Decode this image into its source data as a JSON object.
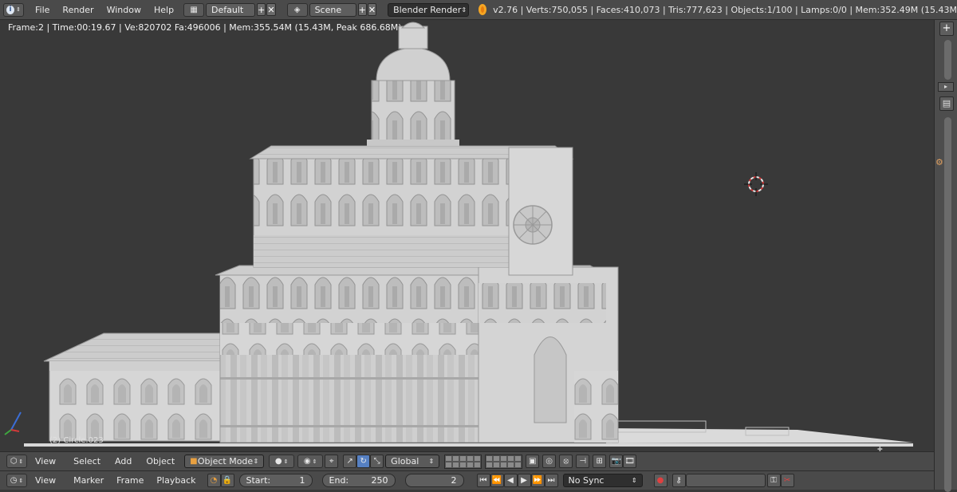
{
  "topbar": {
    "info_icon": "info-icon",
    "menus": [
      "File",
      "Render",
      "Window",
      "Help"
    ],
    "screen_layout": "Default",
    "scene": "Scene",
    "render_engine": "Blender Render",
    "stats": "v2.76 | Verts:750,055 | Faces:410,073 | Tris:777,623 | Objects:1/100 | Lamps:0/0 | Mem:352.49M (15.43M"
  },
  "viewport": {
    "render_stats": "Frame:2 | Time:00:19.67 | Ve:820702 Fa:496006 | Mem:355.54M (15.43M, Peak 686.68M)",
    "object_label": "(2) Circle.023"
  },
  "header3d": {
    "menus": [
      "View",
      "Select",
      "Add",
      "Object"
    ],
    "mode": "Object Mode",
    "orientation": "Global"
  },
  "timeline": {
    "menus": [
      "View",
      "Marker",
      "Frame",
      "Playback"
    ],
    "start_label": "Start:",
    "start_value": "1",
    "end_label": "End:",
    "end_value": "250",
    "current_frame": "2",
    "sync": "No Sync"
  },
  "colors": {
    "background": "#393939",
    "header": "#4a4a4a",
    "accent": "#5680c2",
    "model": "#d9d9d9"
  }
}
